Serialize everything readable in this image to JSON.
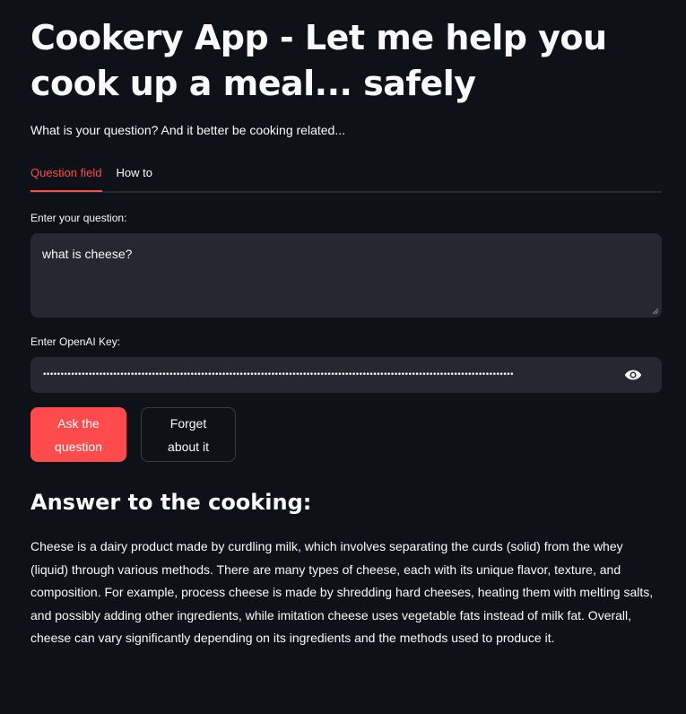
{
  "header": {
    "title": "Cookery App - Let me help you cook up a meal... safely",
    "subtitle": "What is your question? And it better be cooking related..."
  },
  "tabs": [
    {
      "label": "Question field",
      "active": true
    },
    {
      "label": "How to",
      "active": false
    }
  ],
  "question": {
    "label": "Enter your question:",
    "value": "what is cheese?"
  },
  "api_key": {
    "label": "Enter OpenAI Key:",
    "masked_value": "••••••••••••••••••••••••••••••••••••••••••••••••••••••••••••••••••••••••••••••••••••••••••••••••••••••••••••••••••••••••••••••••••••••",
    "toggle_icon": "eye-icon"
  },
  "buttons": {
    "ask_label": "Ask the question",
    "forget_label": "Forget about it"
  },
  "answer": {
    "heading": "Answer to the cooking:",
    "text": "Cheese is a dairy product made by curdling milk, which involves separating the curds (solid) from the whey (liquid) through various methods. There are many types of cheese, each with its unique flavor, texture, and composition. For example, process cheese is made by shredding hard cheeses, heating them with melting salts, and possibly adding other ingredients, while imitation cheese uses vegetable fats instead of milk fat. Overall, cheese can vary significantly depending on its ingredients and the methods used to produce it."
  },
  "colors": {
    "background": "#0e1117",
    "accent": "#ff4b4b",
    "input_background": "#262730",
    "text": "#fafafa"
  }
}
